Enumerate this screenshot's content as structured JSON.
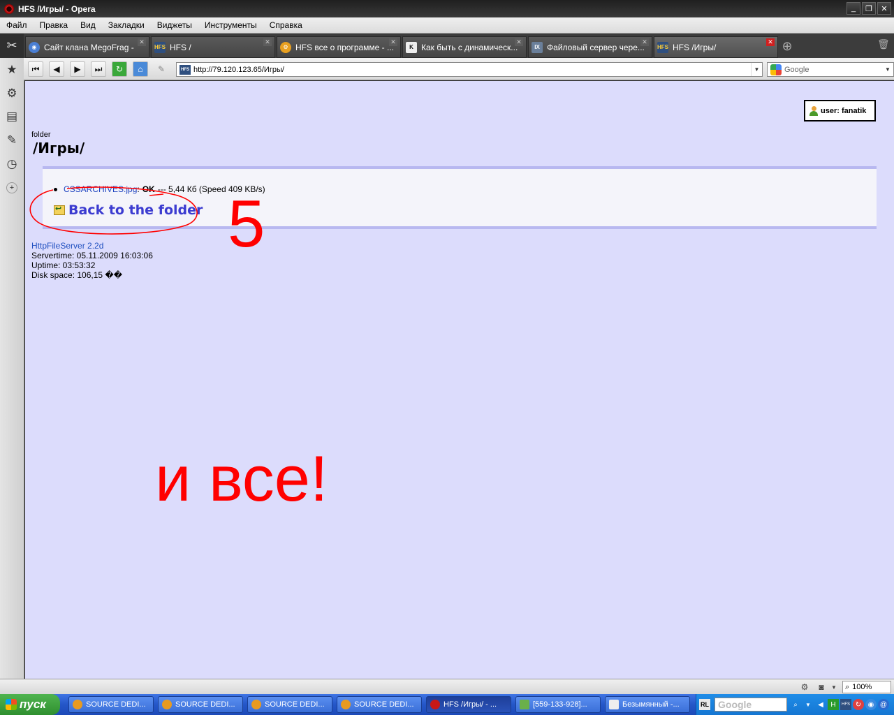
{
  "window": {
    "title": "HFS /Игры/ - Opera"
  },
  "menu": [
    "Файл",
    "Правка",
    "Вид",
    "Закладки",
    "Виджеты",
    "Инструменты",
    "Справка"
  ],
  "tabs": [
    {
      "label": "Сайт клана MegoFrag -",
      "icon": "globe-icon",
      "active": false
    },
    {
      "label": "HFS /",
      "icon": "hfs-icon",
      "active": false
    },
    {
      "label": "HFS все о программе - ...",
      "icon": "gear-icon",
      "active": false
    },
    {
      "label": "Как быть с динамическ...",
      "icon": "k-icon",
      "active": false
    },
    {
      "label": "Файловый сервер чере...",
      "icon": "ix-icon",
      "active": false
    },
    {
      "label": "HFS /Игры/",
      "icon": "hfs-icon",
      "active": true
    }
  ],
  "toolbar": {
    "address": "http://79.120.123.65/Игры/",
    "search_placeholder": "Google"
  },
  "page": {
    "user_label": "user: fanatik",
    "folder_label": "folder",
    "folder_title": "/Игры/",
    "file": {
      "name": "CSSARCHIVES.jpg",
      "separator": ":",
      "status": "OK",
      "details": "--- 5,44 Кб (Speed 409 KB/s)"
    },
    "back_link": "Back to the folder",
    "server_name": "HttpFileServer 2.2d",
    "servertime": "Servertime: 05.11.2009 16:03:06",
    "uptime": "Uptime: 03:53:32",
    "disk_space": "Disk space: 106,15 ��"
  },
  "annotations": {
    "step_number": "5",
    "final_text": "и все!",
    "color": "#ff0000"
  },
  "statusbar": {
    "zoom": "100%"
  },
  "taskbar": {
    "start_label": "пуск",
    "tasks": [
      {
        "label": "SOURCE DEDI...",
        "active": false
      },
      {
        "label": "SOURCE DEDI...",
        "active": false
      },
      {
        "label": "SOURCE DEDI...",
        "active": false
      },
      {
        "label": "SOURCE DEDI...",
        "active": false
      },
      {
        "label": "HFS /Игры/ - ...",
        "active": true
      },
      {
        "label": "[559-133-928]...",
        "active": false
      },
      {
        "label": "Безымянный -...",
        "active": false
      }
    ],
    "tray_lang": "RL",
    "tray_search": "Google"
  },
  "colors": {
    "page_background": "#dcdcfc",
    "link": "#2045c0",
    "back_link": "#3b3bd0",
    "box_border": "#b8b8f0"
  }
}
